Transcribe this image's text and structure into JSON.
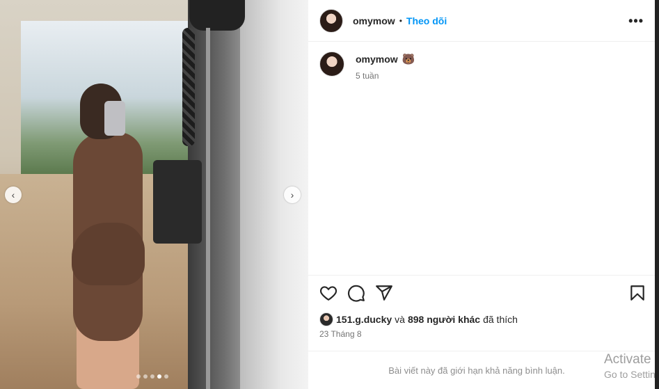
{
  "post": {
    "username": "omymow",
    "separator": "•",
    "follow_label": "Theo dõi",
    "more_label": "•••"
  },
  "caption": {
    "username": "omymow",
    "emoji": "🐻",
    "time": "5 tuần"
  },
  "media": {
    "prev_label": "‹",
    "next_label": "›",
    "carousel_count": 5,
    "carousel_active_index": 3
  },
  "likes": {
    "user": "151.g.ducky",
    "and": "và",
    "others": "898 người khác",
    "liked": "đã thích"
  },
  "date": "23 Tháng 8",
  "comments_off": "Bài viết này đã giới hạn khả năng bình luận.",
  "watermark": {
    "line1": "Activate",
    "line2": "Go to Settin"
  },
  "icons": [
    "heart-icon",
    "comment-icon",
    "share-icon",
    "bookmark-icon",
    "more-icon"
  ]
}
